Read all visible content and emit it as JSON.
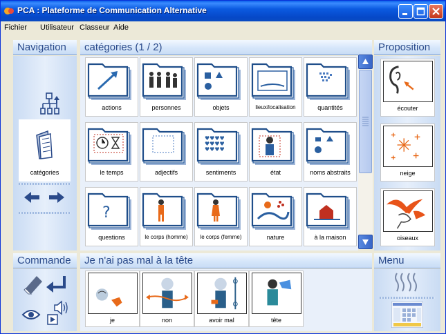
{
  "window": {
    "title": "PCA : Plateforme de Communication Alternative"
  },
  "menu": [
    "Fichier",
    "Utilisateur",
    "Classeur",
    "Aide"
  ],
  "navigation": {
    "header": "Navigation",
    "items": [
      {
        "icon": "hierarchy-icon",
        "label": ""
      },
      {
        "icon": "book-icon",
        "label": "catégories"
      },
      {
        "icon": "left-right-arrows-icon",
        "label": ""
      }
    ]
  },
  "categories": {
    "header": "catégories (1 / 2)",
    "cards": [
      {
        "label": "actions",
        "icon": "arrow-icon"
      },
      {
        "label": "personnes",
        "icon": "people-icon"
      },
      {
        "label": "objets",
        "icon": "shapes-icon"
      },
      {
        "label": "lieux/localisation",
        "icon": "place-icon"
      },
      {
        "label": "quantités",
        "icon": "quantity-icon"
      },
      {
        "label": "le temps",
        "icon": "clock-icon"
      },
      {
        "label": "adjectifs",
        "icon": "dotted-square-icon"
      },
      {
        "label": "sentiments",
        "icon": "hearts-icon"
      },
      {
        "label": "état",
        "icon": "person-state-icon"
      },
      {
        "label": "noms abstraits",
        "icon": "abstract-shapes-icon"
      },
      {
        "label": "questions",
        "icon": "question-icon"
      },
      {
        "label": "le corps (homme)",
        "icon": "body-man-icon"
      },
      {
        "label": "le corps (femme)",
        "icon": "body-woman-icon"
      },
      {
        "label": "nature",
        "icon": "nature-icon"
      },
      {
        "label": "à la maison",
        "icon": "house-icon"
      }
    ]
  },
  "proposition": {
    "header": "Proposition",
    "cards": [
      {
        "label": "écouter",
        "icon": "ear-icon"
      },
      {
        "label": "neige",
        "icon": "snow-icon"
      },
      {
        "label": "oiseaux",
        "icon": "birds-icon"
      }
    ]
  },
  "commande": {
    "header": "Commande"
  },
  "sentence": {
    "header": "Je n'ai pas mal à la tête",
    "cards": [
      {
        "label": "je",
        "icon": "me-icon"
      },
      {
        "label": "non",
        "icon": "no-icon"
      },
      {
        "label": "avoir mal",
        "icon": "pain-icon"
      },
      {
        "label": "tête",
        "icon": "head-icon"
      }
    ]
  },
  "menu_panel": {
    "header": "Menu"
  },
  "colors": {
    "accent": "#2a4a8a",
    "folder_blue": "#2d5f9e",
    "titlebar": "#0a4bc2"
  }
}
